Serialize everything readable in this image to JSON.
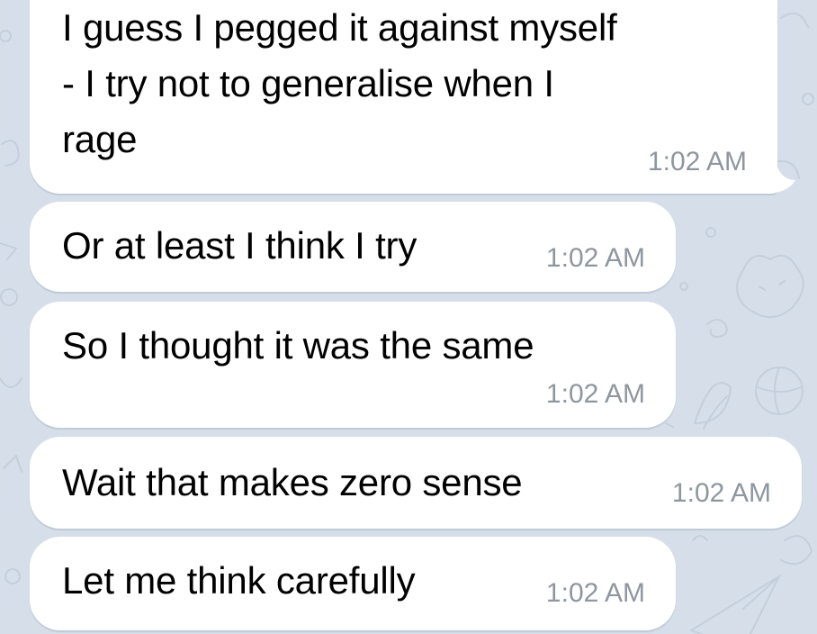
{
  "messages": [
    {
      "text": "I guess I pegged it against myself - I try not to generalise when I rage",
      "lines": [
        "I guess I pegged it against myself",
        "- I try not to generalise when I",
        "rage"
      ],
      "time": "1:02 AM"
    },
    {
      "text": "Or at least I think I try",
      "time": "1:02 AM"
    },
    {
      "text": "So I thought it was the same",
      "time": "1:02 AM"
    },
    {
      "text": "Wait that makes zero sense",
      "time": "1:02 AM"
    },
    {
      "text": "Let me think carefully",
      "time": "1:02 AM"
    }
  ],
  "colors": {
    "background": "#d6dfe9",
    "bubble": "#ffffff",
    "timestamp": "#8e979f",
    "text": "#000000"
  }
}
